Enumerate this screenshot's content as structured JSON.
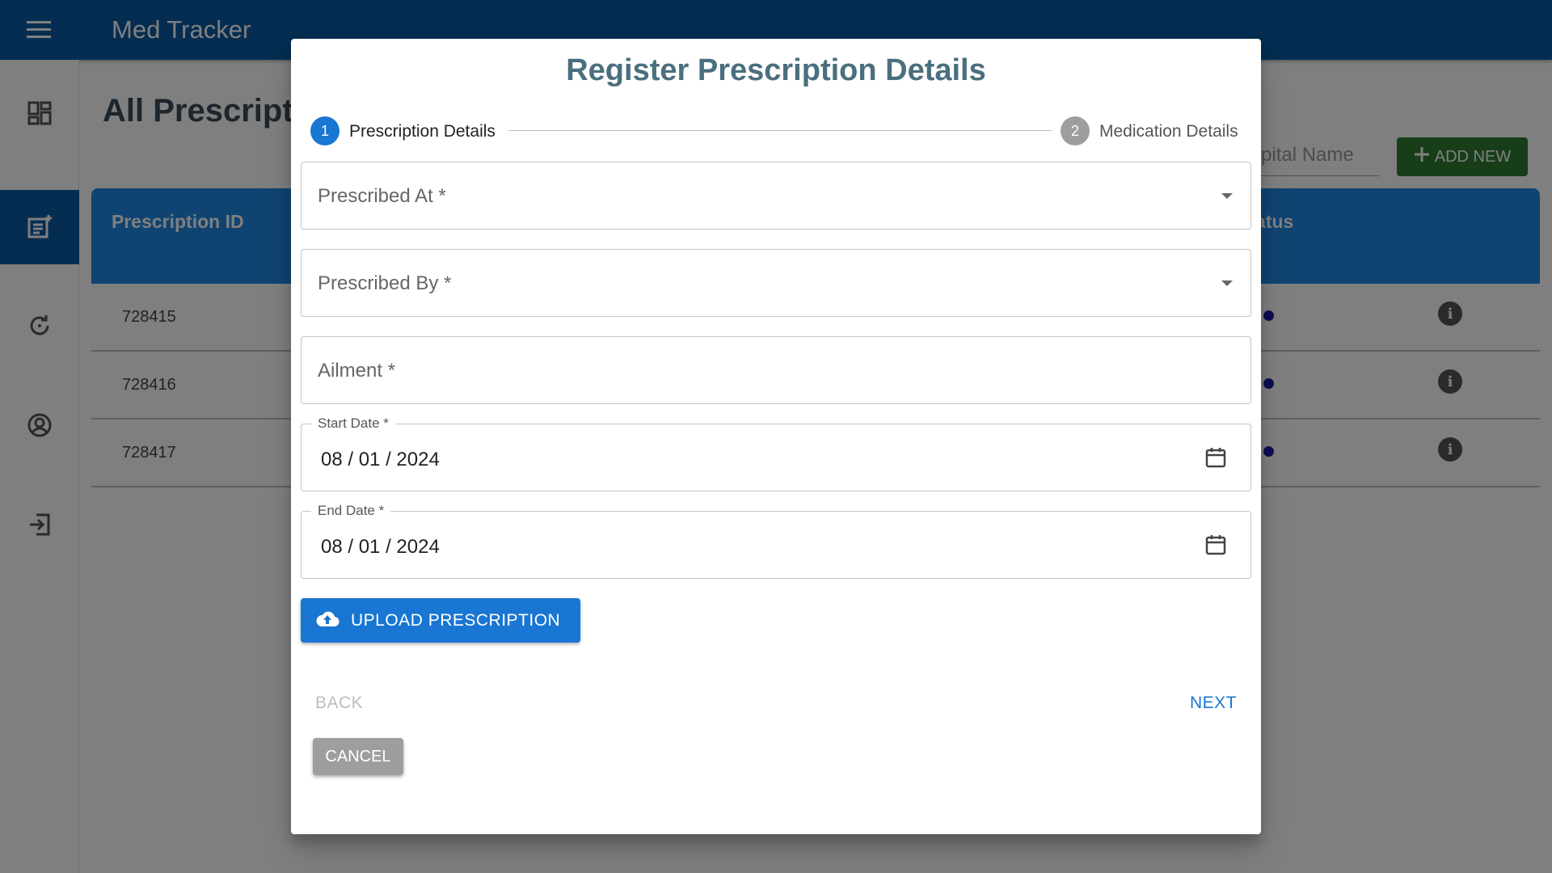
{
  "app": {
    "title": "Med Tracker",
    "page_title": "All Prescript",
    "search_placeholder": "pital Name",
    "add_button": "ADD NEW",
    "sidebar": [
      "dashboard-icon",
      "add-prescription-icon",
      "refresh-icon",
      "account-icon",
      "logout-icon"
    ],
    "table": {
      "headers": [
        "Prescription ID",
        "atus"
      ],
      "rows": [
        {
          "id": "728415"
        },
        {
          "id": "728416"
        },
        {
          "id": "728417"
        }
      ]
    }
  },
  "dialog": {
    "title": "Register Prescription Details",
    "steps": [
      {
        "number": "1",
        "label": "Prescription Details",
        "active": true
      },
      {
        "number": "2",
        "label": "Medication Details",
        "active": false
      }
    ],
    "fields": {
      "prescribed_at": "Prescribed At *",
      "prescribed_by": "Prescribed By *",
      "ailment": "Ailment *",
      "start_date_label": "Start Date *",
      "start_date_value": "08 / 01 / 2024",
      "end_date_label": "End Date *",
      "end_date_value": "08 / 01 / 2024"
    },
    "upload_button": "UPLOAD PRESCRIPTION",
    "back_button": "BACK",
    "next_button": "NEXT",
    "cancel_button": "CANCEL"
  },
  "colors": {
    "primary": "#1976d2",
    "app_bar": "#0b5aa5",
    "add_button": "#2e7d32",
    "step_inactive": "#9e9e9e",
    "title": "#4a6f7e"
  }
}
